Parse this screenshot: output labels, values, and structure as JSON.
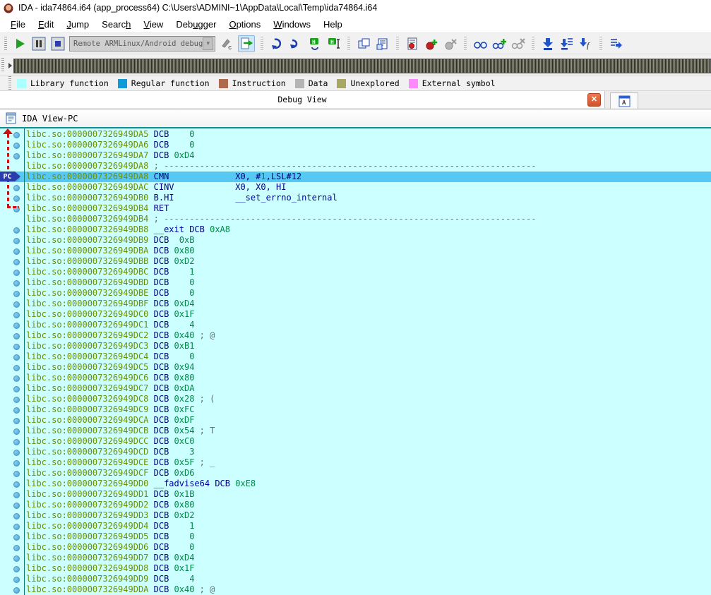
{
  "window": {
    "title": "IDA - ida74864.i64 (app_process64) C:\\Users\\ADMINI~1\\AppData\\Local\\Temp\\ida74864.i64"
  },
  "menu": {
    "items": [
      {
        "pre": "",
        "accel": "F",
        "post": "ile"
      },
      {
        "pre": "",
        "accel": "E",
        "post": "dit"
      },
      {
        "pre": "",
        "accel": "J",
        "post": "ump"
      },
      {
        "pre": "Searc",
        "accel": "h",
        "post": ""
      },
      {
        "pre": "",
        "accel": "V",
        "post": "iew"
      },
      {
        "pre": "Deb",
        "accel": "u",
        "post": "gger"
      },
      {
        "pre": "",
        "accel": "O",
        "post": "ptions"
      },
      {
        "pre": "",
        "accel": "W",
        "post": "indows"
      },
      {
        "pre": "Help",
        "accel": "",
        "post": ""
      }
    ]
  },
  "toolbar": {
    "debugger_select": "Remote ARMLinux/Android debugger",
    "dropdown_glyph": "▼"
  },
  "icons": {
    "ida-logo-icon": "ida-face",
    "start-process-icon": "green-play",
    "pause-process-icon": "pause-bars",
    "stop-process-icon": "blue-square",
    "attach-to-process-icon": "pencil-c",
    "continue-process-icon": "doc-green-arrow",
    "step-into-icon": "blue-curl-left",
    "step-over-icon": "blue-curl-right",
    "run-until-return-icon": "h-box-curl",
    "run-to-cursor-icon": "h-box-cursor",
    "open-windows-icon": "stacked-windows",
    "window-list-icon": "window-lines",
    "breakpoint-list-icon": "doc-red-dot",
    "add-breakpoint-icon": "red-pin-plus",
    "delete-breakpoint-icon": "gray-pin-x",
    "watch-list-icon": "binoculars",
    "add-watch-icon": "binoculars-plus",
    "delete-watch-icon": "binoculars-x",
    "trace-into-icon": "arrow-down-bar",
    "trace-over-icon": "arrow-down-list",
    "trace-function-icon": "arrow-down-f",
    "run-to-icon": "list-arrow-right",
    "close-icon": "✕",
    "ida-view-a-icon": "A",
    "ida-view-pc-icon": "document-window",
    "nav-arrow-icon": "▶"
  },
  "legend": {
    "items": [
      {
        "label": "Library function",
        "color": "#aaffff"
      },
      {
        "label": "Regular function",
        "color": "#0f9bd7"
      },
      {
        "label": "Instruction",
        "color": "#ad6a4d"
      },
      {
        "label": "Data",
        "color": "#b4b4b4"
      },
      {
        "label": "Unexplored",
        "color": "#a8a864"
      },
      {
        "label": "External symbol",
        "color": "#ff8aff"
      }
    ]
  },
  "tabs": {
    "debug_view": "Debug View"
  },
  "view": {
    "caption": "IDA View-PC",
    "pc_label": "PC"
  },
  "disasm": {
    "colors": {
      "bg": "#ccffff",
      "highlight": "#57c8f3",
      "address": "#6e8f00",
      "mnemonic": "#000080",
      "number": "#008847",
      "name": "#00009e",
      "comment": "#5f7070"
    },
    "lines": [
      {
        "a": "libc.so:0000007326949DA5",
        "s": [
          [
            "mn",
            "DCB "
          ],
          [
            "num",
            "   0"
          ]
        ],
        "dot": true,
        "hl": false
      },
      {
        "a": "libc.so:0000007326949DA6",
        "s": [
          [
            "mn",
            "DCB "
          ],
          [
            "num",
            "   0"
          ]
        ],
        "dot": true,
        "hl": false
      },
      {
        "a": "libc.so:0000007326949DA7",
        "s": [
          [
            "mn",
            "DCB "
          ],
          [
            "num",
            "0xD4"
          ]
        ],
        "dot": true,
        "hl": false
      },
      {
        "a": "libc.so:0000007326949DA8",
        "s": [
          [
            "cmt",
            "; -------------------------------------------------------------------------"
          ]
        ],
        "dot": false,
        "hl": false
      },
      {
        "a": "libc.so:0000007326949DA8",
        "s": [
          [
            "mn",
            "CMN             "
          ],
          [
            "op",
            "X0, #"
          ],
          [
            "num",
            "1"
          ],
          [
            "op",
            ",LSL#12"
          ]
        ],
        "dot": true,
        "hl": true
      },
      {
        "a": "libc.so:0000007326949DAC",
        "s": [
          [
            "mn",
            "CINV            "
          ],
          [
            "op",
            "X0, X0, HI"
          ]
        ],
        "dot": true,
        "hl": false
      },
      {
        "a": "libc.so:0000007326949DB0",
        "s": [
          [
            "mn",
            "B.HI            "
          ],
          [
            "name",
            "__set_errno_internal"
          ]
        ],
        "dot": true,
        "hl": false
      },
      {
        "a": "libc.so:0000007326949DB4",
        "s": [
          [
            "mn",
            "RET"
          ]
        ],
        "dot": true,
        "hl": false
      },
      {
        "a": "libc.so:0000007326949DB4",
        "s": [
          [
            "cmt",
            "; -------------------------------------------------------------------------"
          ]
        ],
        "dot": false,
        "hl": false
      },
      {
        "a": "libc.so:0000007326949DB8",
        "s": [
          [
            "name",
            "__exit "
          ],
          [
            "mn",
            "DCB "
          ],
          [
            "num",
            "0xA8"
          ]
        ],
        "dot": true,
        "hl": false
      },
      {
        "a": "libc.so:0000007326949DB9",
        "s": [
          [
            "mn",
            "DCB "
          ],
          [
            "num",
            " 0xB"
          ]
        ],
        "dot": true,
        "hl": false
      },
      {
        "a": "libc.so:0000007326949DBA",
        "s": [
          [
            "mn",
            "DCB "
          ],
          [
            "num",
            "0x80"
          ]
        ],
        "dot": true,
        "hl": false
      },
      {
        "a": "libc.so:0000007326949DBB",
        "s": [
          [
            "mn",
            "DCB "
          ],
          [
            "num",
            "0xD2"
          ]
        ],
        "dot": true,
        "hl": false
      },
      {
        "a": "libc.so:0000007326949DBC",
        "s": [
          [
            "mn",
            "DCB "
          ],
          [
            "num",
            "   1"
          ]
        ],
        "dot": true,
        "hl": false
      },
      {
        "a": "libc.so:0000007326949DBD",
        "s": [
          [
            "mn",
            "DCB "
          ],
          [
            "num",
            "   0"
          ]
        ],
        "dot": true,
        "hl": false
      },
      {
        "a": "libc.so:0000007326949DBE",
        "s": [
          [
            "mn",
            "DCB "
          ],
          [
            "num",
            "   0"
          ]
        ],
        "dot": true,
        "hl": false
      },
      {
        "a": "libc.so:0000007326949DBF",
        "s": [
          [
            "mn",
            "DCB "
          ],
          [
            "num",
            "0xD4"
          ]
        ],
        "dot": true,
        "hl": false
      },
      {
        "a": "libc.so:0000007326949DC0",
        "s": [
          [
            "mn",
            "DCB "
          ],
          [
            "num",
            "0x1F"
          ]
        ],
        "dot": true,
        "hl": false
      },
      {
        "a": "libc.so:0000007326949DC1",
        "s": [
          [
            "mn",
            "DCB "
          ],
          [
            "num",
            "   4"
          ]
        ],
        "dot": true,
        "hl": false
      },
      {
        "a": "libc.so:0000007326949DC2",
        "s": [
          [
            "mn",
            "DCB "
          ],
          [
            "num",
            "0x40"
          ],
          [
            "cmt",
            " ; @"
          ]
        ],
        "dot": true,
        "hl": false
      },
      {
        "a": "libc.so:0000007326949DC3",
        "s": [
          [
            "mn",
            "DCB "
          ],
          [
            "num",
            "0xB1"
          ]
        ],
        "dot": true,
        "hl": false
      },
      {
        "a": "libc.so:0000007326949DC4",
        "s": [
          [
            "mn",
            "DCB "
          ],
          [
            "num",
            "   0"
          ]
        ],
        "dot": true,
        "hl": false
      },
      {
        "a": "libc.so:0000007326949DC5",
        "s": [
          [
            "mn",
            "DCB "
          ],
          [
            "num",
            "0x94"
          ]
        ],
        "dot": true,
        "hl": false
      },
      {
        "a": "libc.so:0000007326949DC6",
        "s": [
          [
            "mn",
            "DCB "
          ],
          [
            "num",
            "0x80"
          ]
        ],
        "dot": true,
        "hl": false
      },
      {
        "a": "libc.so:0000007326949DC7",
        "s": [
          [
            "mn",
            "DCB "
          ],
          [
            "num",
            "0xDA"
          ]
        ],
        "dot": true,
        "hl": false
      },
      {
        "a": "libc.so:0000007326949DC8",
        "s": [
          [
            "mn",
            "DCB "
          ],
          [
            "num",
            "0x28"
          ],
          [
            "cmt",
            " ; ("
          ]
        ],
        "dot": true,
        "hl": false
      },
      {
        "a": "libc.so:0000007326949DC9",
        "s": [
          [
            "mn",
            "DCB "
          ],
          [
            "num",
            "0xFC"
          ]
        ],
        "dot": true,
        "hl": false
      },
      {
        "a": "libc.so:0000007326949DCA",
        "s": [
          [
            "mn",
            "DCB "
          ],
          [
            "num",
            "0xDF"
          ]
        ],
        "dot": true,
        "hl": false
      },
      {
        "a": "libc.so:0000007326949DCB",
        "s": [
          [
            "mn",
            "DCB "
          ],
          [
            "num",
            "0x54"
          ],
          [
            "cmt",
            " ; T"
          ]
        ],
        "dot": true,
        "hl": false
      },
      {
        "a": "libc.so:0000007326949DCC",
        "s": [
          [
            "mn",
            "DCB "
          ],
          [
            "num",
            "0xC0"
          ]
        ],
        "dot": true,
        "hl": false
      },
      {
        "a": "libc.so:0000007326949DCD",
        "s": [
          [
            "mn",
            "DCB "
          ],
          [
            "num",
            "   3"
          ]
        ],
        "dot": true,
        "hl": false
      },
      {
        "a": "libc.so:0000007326949DCE",
        "s": [
          [
            "mn",
            "DCB "
          ],
          [
            "num",
            "0x5F"
          ],
          [
            "cmt",
            " ; _"
          ]
        ],
        "dot": true,
        "hl": false
      },
      {
        "a": "libc.so:0000007326949DCF",
        "s": [
          [
            "mn",
            "DCB "
          ],
          [
            "num",
            "0xD6"
          ]
        ],
        "dot": true,
        "hl": false
      },
      {
        "a": "libc.so:0000007326949DD0",
        "s": [
          [
            "name",
            "__fadvise64 "
          ],
          [
            "mn",
            "DCB "
          ],
          [
            "num",
            "0xE8"
          ]
        ],
        "dot": true,
        "hl": false
      },
      {
        "a": "libc.so:0000007326949DD1",
        "s": [
          [
            "mn",
            "DCB "
          ],
          [
            "num",
            "0x1B"
          ]
        ],
        "dot": true,
        "hl": false
      },
      {
        "a": "libc.so:0000007326949DD2",
        "s": [
          [
            "mn",
            "DCB "
          ],
          [
            "num",
            "0x80"
          ]
        ],
        "dot": true,
        "hl": false
      },
      {
        "a": "libc.so:0000007326949DD3",
        "s": [
          [
            "mn",
            "DCB "
          ],
          [
            "num",
            "0xD2"
          ]
        ],
        "dot": true,
        "hl": false
      },
      {
        "a": "libc.so:0000007326949DD4",
        "s": [
          [
            "mn",
            "DCB "
          ],
          [
            "num",
            "   1"
          ]
        ],
        "dot": true,
        "hl": false
      },
      {
        "a": "libc.so:0000007326949DD5",
        "s": [
          [
            "mn",
            "DCB "
          ],
          [
            "num",
            "   0"
          ]
        ],
        "dot": true,
        "hl": false
      },
      {
        "a": "libc.so:0000007326949DD6",
        "s": [
          [
            "mn",
            "DCB "
          ],
          [
            "num",
            "   0"
          ]
        ],
        "dot": true,
        "hl": false
      },
      {
        "a": "libc.so:0000007326949DD7",
        "s": [
          [
            "mn",
            "DCB "
          ],
          [
            "num",
            "0xD4"
          ]
        ],
        "dot": true,
        "hl": false
      },
      {
        "a": "libc.so:0000007326949DD8",
        "s": [
          [
            "mn",
            "DCB "
          ],
          [
            "num",
            "0x1F"
          ]
        ],
        "dot": true,
        "hl": false
      },
      {
        "a": "libc.so:0000007326949DD9",
        "s": [
          [
            "mn",
            "DCB "
          ],
          [
            "num",
            "   4"
          ]
        ],
        "dot": true,
        "hl": false
      },
      {
        "a": "libc.so:0000007326949DDA",
        "s": [
          [
            "mn",
            "DCB "
          ],
          [
            "num",
            "0x40"
          ],
          [
            "cmt",
            " ; @"
          ]
        ],
        "dot": true,
        "hl": false
      }
    ]
  }
}
